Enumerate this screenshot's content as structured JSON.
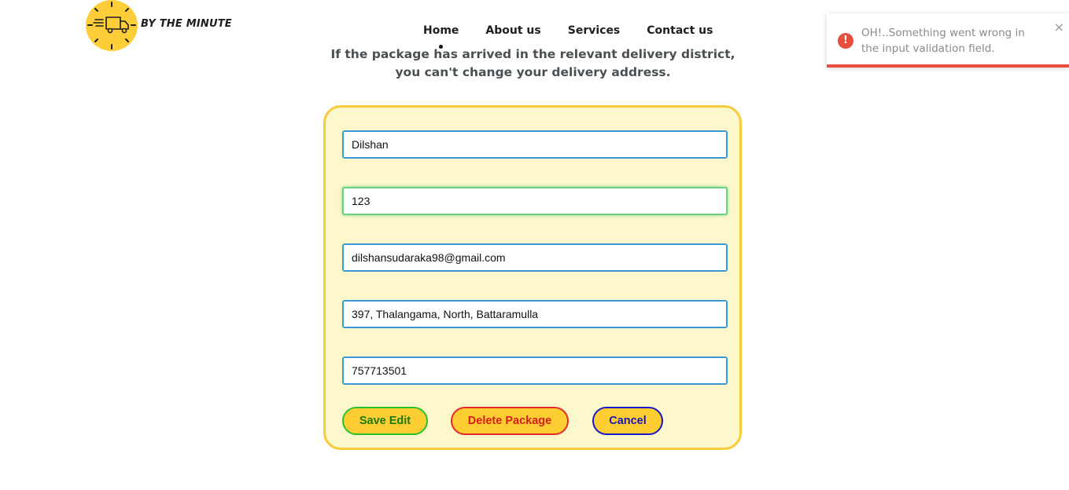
{
  "brand": {
    "name": "BY THE MINUTE",
    "logo_icon": "delivery-truck-clock-icon"
  },
  "nav": {
    "items": [
      "Home",
      "About us",
      "Services",
      "Contact us"
    ]
  },
  "notice": {
    "line1": "If the package has arrived in the relevant delivery district,",
    "line2": "you can't change your delivery address."
  },
  "form": {
    "name": "Dilshan",
    "package_id": "123",
    "email": "dilshansudaraka98@gmail.com",
    "address": "397, Thalangama, North, Battaramulla",
    "phone": "757713501"
  },
  "buttons": {
    "save": "Save Edit",
    "delete": "Delete Package",
    "cancel": "Cancel"
  },
  "toast": {
    "message": "OH!..Something went wrong in the input validation field.",
    "icon": "error-exclamation-icon",
    "close": "×"
  },
  "colors": {
    "accent": "#fecd3a",
    "card_bg": "#fdf8cc",
    "error": "#e74c3c",
    "input_border": "#3a9ad8"
  }
}
